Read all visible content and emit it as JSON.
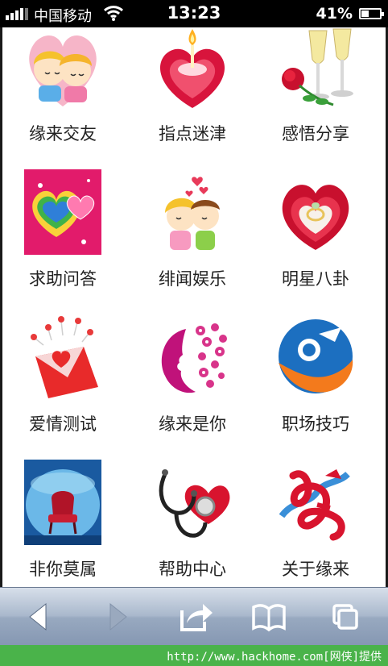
{
  "status_bar": {
    "carrier": "中国移动",
    "time": "13:23",
    "battery": "41%",
    "battery_level": 0.41
  },
  "tiles": [
    {
      "label": "缘来交友"
    },
    {
      "label": "指点迷津"
    },
    {
      "label": "感悟分享"
    },
    {
      "label": "求助问答"
    },
    {
      "label": "绯闻娱乐"
    },
    {
      "label": "明星八卦"
    },
    {
      "label": "爱情测试"
    },
    {
      "label": "缘来是你"
    },
    {
      "label": "职场技巧"
    },
    {
      "label": "非你莫属"
    },
    {
      "label": "帮助中心"
    },
    {
      "label": "关于缘来"
    }
  ],
  "toolbar": {
    "buttons": [
      "back-icon",
      "forward-icon",
      "share-icon",
      "bookmarks-icon",
      "tabs-icon"
    ]
  },
  "footer": {
    "text": "http://www.hackhome.com[网侠]提供"
  },
  "colors": {
    "toolbar": "#a9b8cc",
    "footer": "#4ab34a",
    "statusbar": "#000000"
  }
}
